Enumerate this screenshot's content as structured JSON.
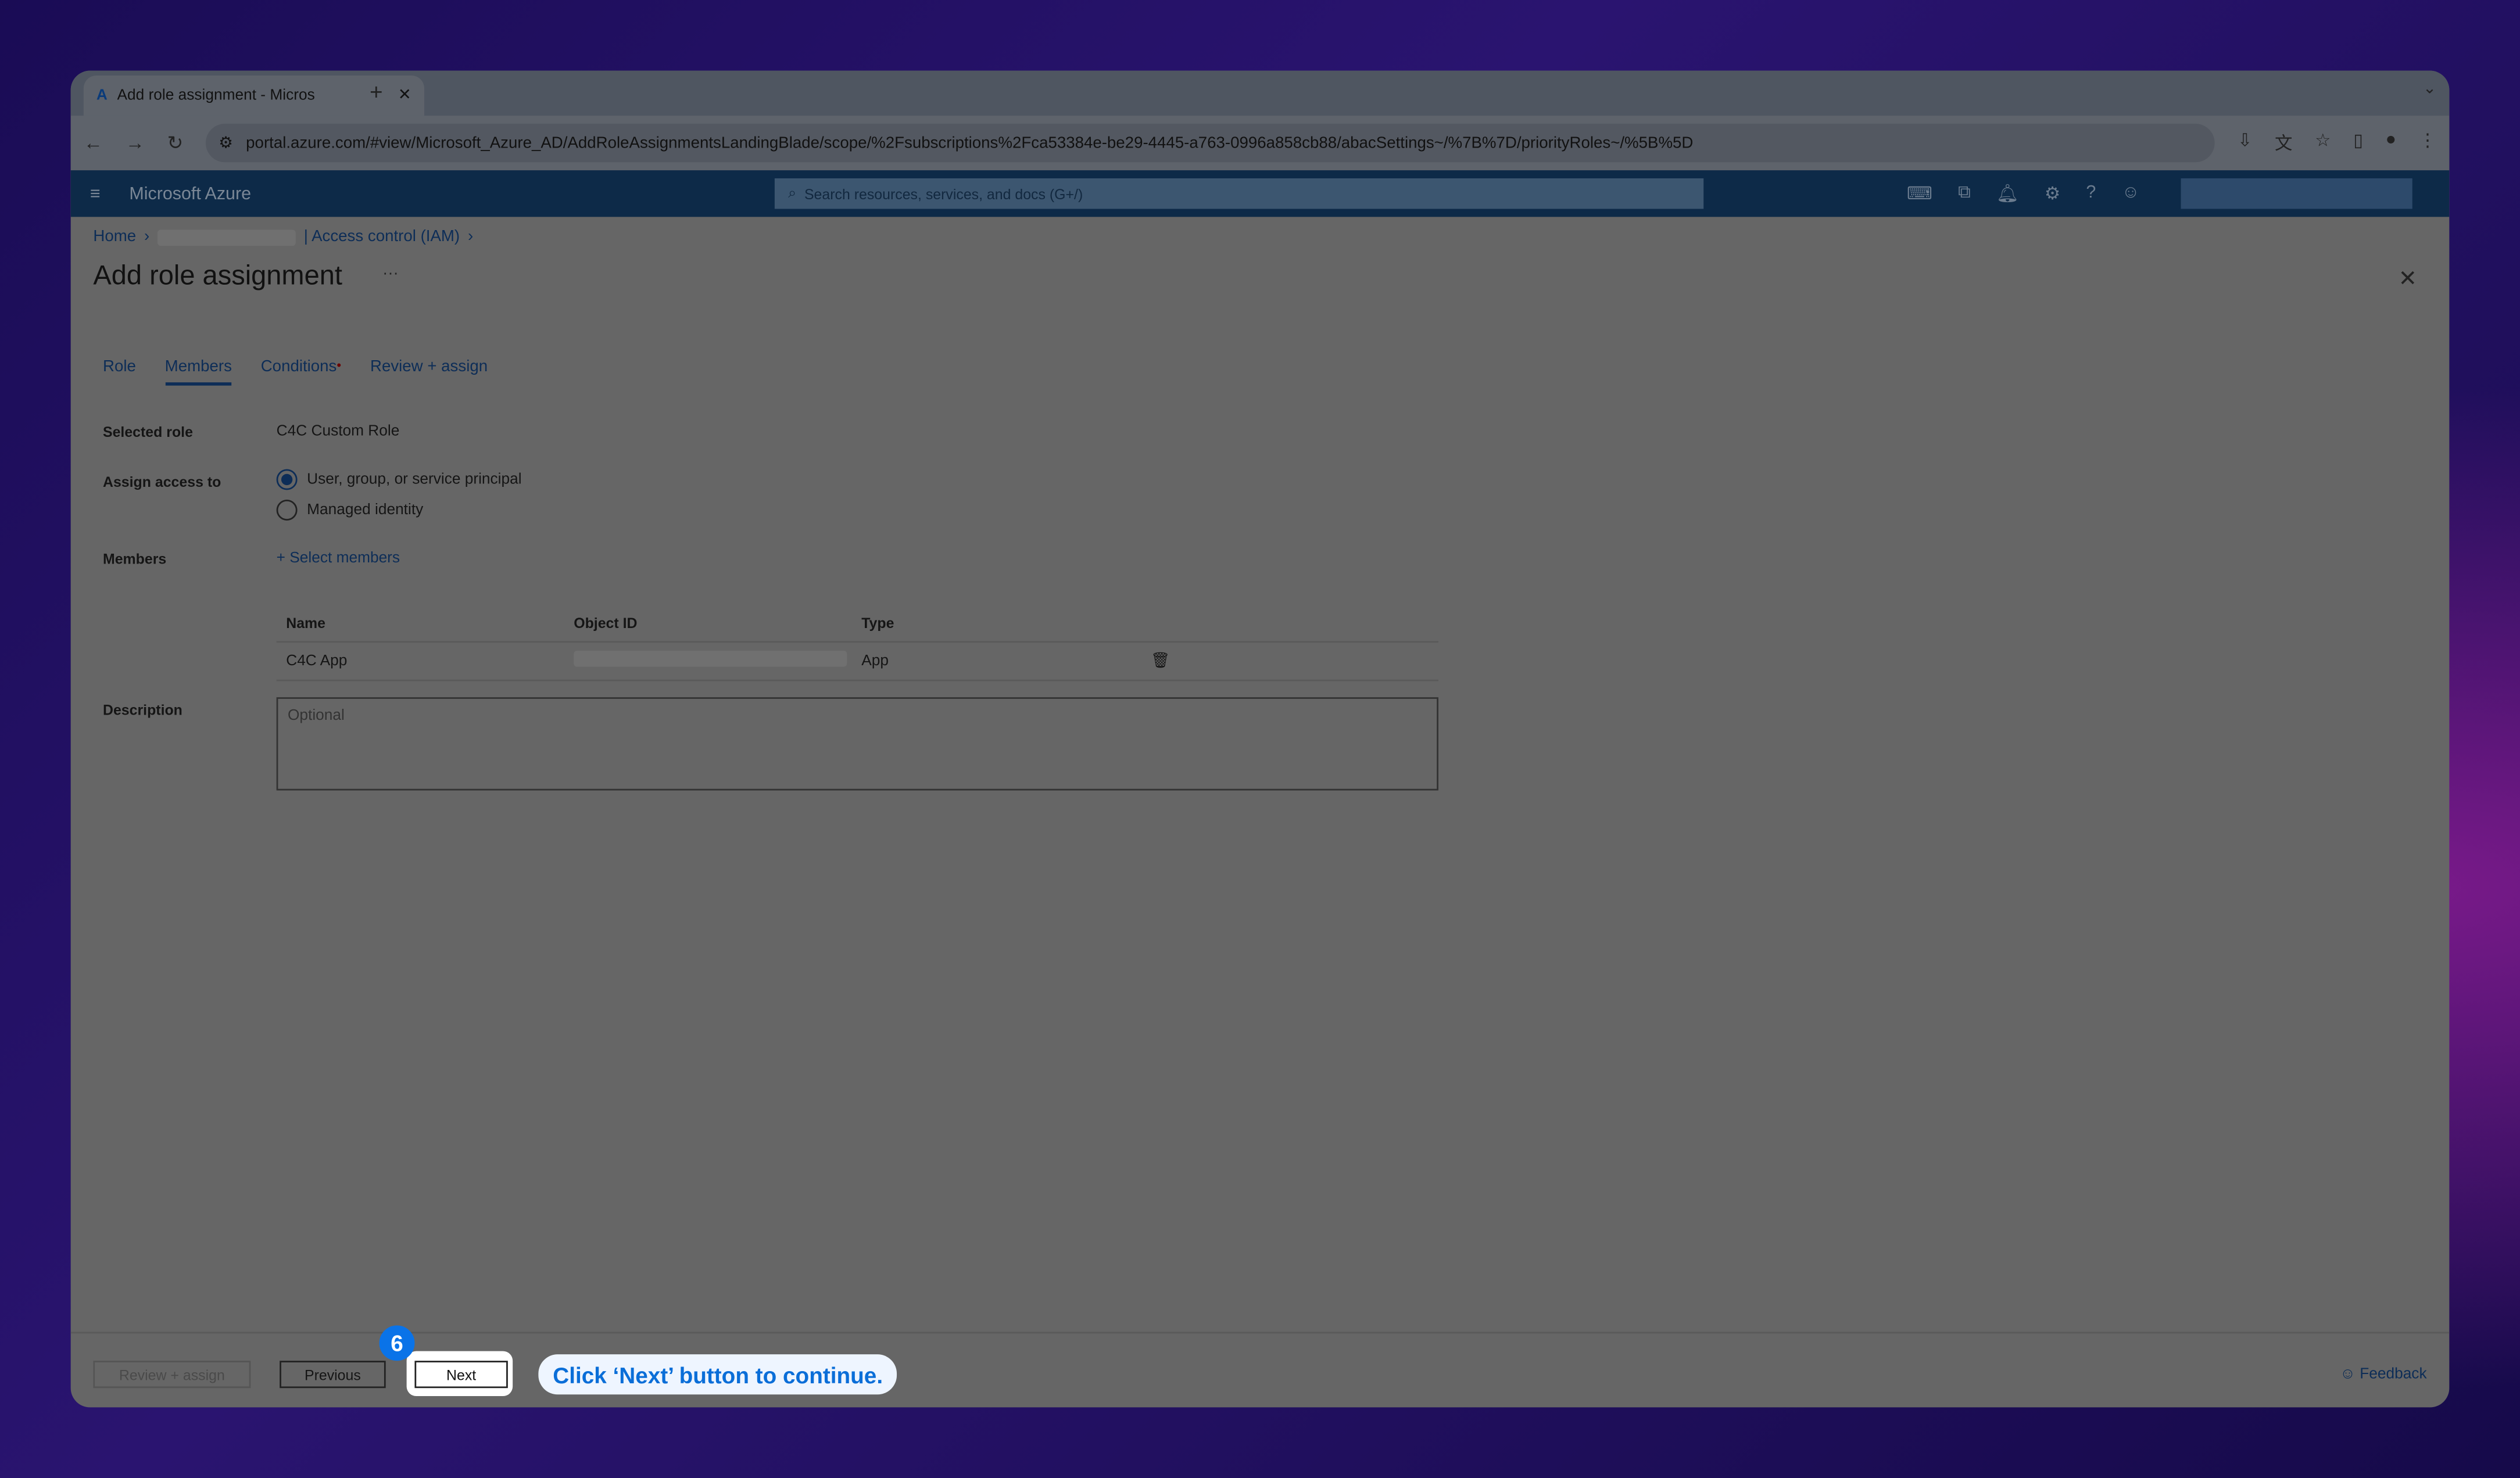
{
  "browser": {
    "tab_title": "Add role assignment - Micros",
    "url": "portal.azure.com/#view/Microsoft_Azure_AD/AddRoleAssignmentsLandingBlade/scope/%2Fsubscriptions%2Fca53384e-be29-4445-a763-0996a858cb88/abacSettings~/%7B%7D/priorityRoles~/%5B%5D"
  },
  "header": {
    "brand": "Microsoft Azure",
    "search_placeholder": "Search resources, services, and docs (G+/)"
  },
  "breadcrumb": {
    "home": "Home",
    "iam": "| Access control (IAM)"
  },
  "page": {
    "title": "Add role assignment",
    "more": "···"
  },
  "tabs": [
    {
      "label": "Role"
    },
    {
      "label": "Members"
    },
    {
      "label": "Conditions",
      "required": "•"
    },
    {
      "label": "Review + assign"
    }
  ],
  "form": {
    "selected_role_label": "Selected role",
    "selected_role": "C4C Custom Role",
    "assign_label": "Assign access to",
    "options": [
      "User, group, or service principal",
      "Managed identity"
    ],
    "members_label": "Members",
    "select_members": "+ Select members",
    "description_label": "Description",
    "description_placeholder": "Optional"
  },
  "table": {
    "headers": [
      "Name",
      "Object ID",
      "Type"
    ],
    "rows": [
      {
        "name": "C4C App",
        "type": "App"
      }
    ]
  },
  "footer": {
    "review": "Review + assign",
    "previous": "Previous",
    "next": "Next",
    "step": "6",
    "callout": "Click ‘Next’ button to continue.",
    "feedback": "Feedback"
  }
}
